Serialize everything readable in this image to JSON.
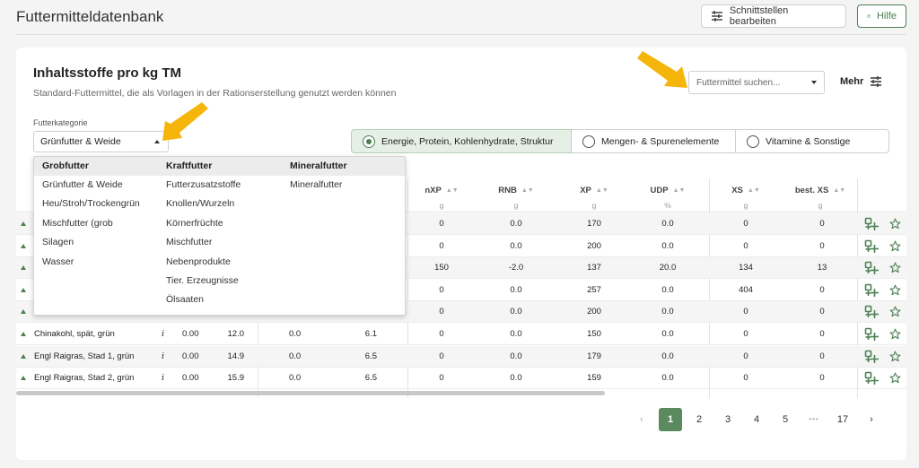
{
  "app": {
    "title": "Futtermitteldatenbank"
  },
  "toolbar": {
    "interfaces_label": "Schnittstellen bearbeiten",
    "help_label": "Hilfe"
  },
  "card": {
    "title": "Inhaltsstoffe pro kg TM",
    "subtitle": "Standard-Futtermittel, die als Vorlagen in der Rationserstellung genutzt werden können",
    "search_placeholder": "Futtermittel suchen...",
    "more_label": "Mehr"
  },
  "category": {
    "label": "Futterkategorie",
    "value": "Grünfutter & Weide"
  },
  "view_options": [
    {
      "label": "Energie, Protein, Kohlenhydrate, Struktur",
      "selected": true
    },
    {
      "label": "Mengen- & Spurenelemente",
      "selected": false
    },
    {
      "label": "Vitamine & Sonstige",
      "selected": false
    }
  ],
  "dropdown": {
    "groups": [
      {
        "header": "Grobfutter",
        "items": [
          "Grünfutter & Weide",
          "Heu/Stroh/Trockengrün",
          "Mischfutter (grob",
          "Silagen",
          "Wasser"
        ]
      },
      {
        "header": "Kraftfutter",
        "items": [
          "Futterzusatzstoffe",
          "Knollen/Wurzeln",
          "Körnerfrüchte",
          "Mischfutter",
          "Nebenprodukte",
          "Tier. Erzeugnisse",
          "Ölsaaten"
        ]
      },
      {
        "header": "Mineralfutter",
        "items": [
          "Mineralfutter"
        ]
      }
    ]
  },
  "table": {
    "columns": [
      {
        "label": "nXP",
        "unit": "g"
      },
      {
        "label": "RNB",
        "unit": "g"
      },
      {
        "label": "XP",
        "unit": "g"
      },
      {
        "label": "UDP",
        "unit": "%"
      },
      {
        "label": "XS",
        "unit": "g"
      },
      {
        "label": "best. XS",
        "unit": "g"
      }
    ],
    "rows": [
      {
        "name": "",
        "info": "",
        "c1": "",
        "c2": "",
        "c3": "",
        "c4": "",
        "nXP": "0",
        "RNB": "0.0",
        "XP": "170",
        "UDP": "0.0",
        "XS": "0",
        "bestXS": "0"
      },
      {
        "name": "",
        "info": "",
        "c1": "",
        "c2": "",
        "c3": "",
        "c4": "",
        "nXP": "0",
        "RNB": "0.0",
        "XP": "200",
        "UDP": "0.0",
        "XS": "0",
        "bestXS": "0"
      },
      {
        "name": "",
        "info": "",
        "c1": "",
        "c2": "",
        "c3": "",
        "c4": "",
        "nXP": "150",
        "RNB": "-2.0",
        "XP": "137",
        "UDP": "20.0",
        "XS": "134",
        "bestXS": "13"
      },
      {
        "name": "",
        "info": "",
        "c1": "",
        "c2": "",
        "c3": "",
        "c4": "",
        "nXP": "0",
        "RNB": "0.0",
        "XP": "257",
        "UDP": "0.0",
        "XS": "404",
        "bestXS": "0"
      },
      {
        "name": "",
        "info": "",
        "c1": "",
        "c2": "",
        "c3": "",
        "c4": "",
        "nXP": "0",
        "RNB": "0.0",
        "XP": "200",
        "UDP": "0.0",
        "XS": "0",
        "bestXS": "0"
      },
      {
        "name": "Chinakohl, spät, grün",
        "info": "i",
        "c1": "0.00",
        "c2": "12.0",
        "c3": "0.0",
        "c4": "6.1",
        "nXP": "0",
        "RNB": "0.0",
        "XP": "150",
        "UDP": "0.0",
        "XS": "0",
        "bestXS": "0"
      },
      {
        "name": "Engl Raigras, Stad 1, grün",
        "info": "i",
        "c1": "0.00",
        "c2": "14.9",
        "c3": "0.0",
        "c4": "6.5",
        "nXP": "0",
        "RNB": "0.0",
        "XP": "179",
        "UDP": "0.0",
        "XS": "0",
        "bestXS": "0"
      },
      {
        "name": "Engl Raigras, Stad 2, grün",
        "info": "i",
        "c1": "0.00",
        "c2": "15.9",
        "c3": "0.0",
        "c4": "6.5",
        "nXP": "0",
        "RNB": "0.0",
        "XP": "159",
        "UDP": "0.0",
        "XS": "0",
        "bestXS": "0"
      }
    ]
  },
  "pagination": {
    "prev": "‹",
    "pages": [
      "1",
      "2",
      "3",
      "4",
      "5"
    ],
    "ellipsis": "•••",
    "last": "17",
    "next": "›",
    "current": "1"
  },
  "colors": {
    "accent": "#4d7f52",
    "arrow": "#f5b50a"
  },
  "icons": [
    "sliders-icon",
    "help-icon",
    "chevron-down-icon",
    "add-to-ration-icon",
    "star-icon",
    "arrow-pointer-icon"
  ]
}
